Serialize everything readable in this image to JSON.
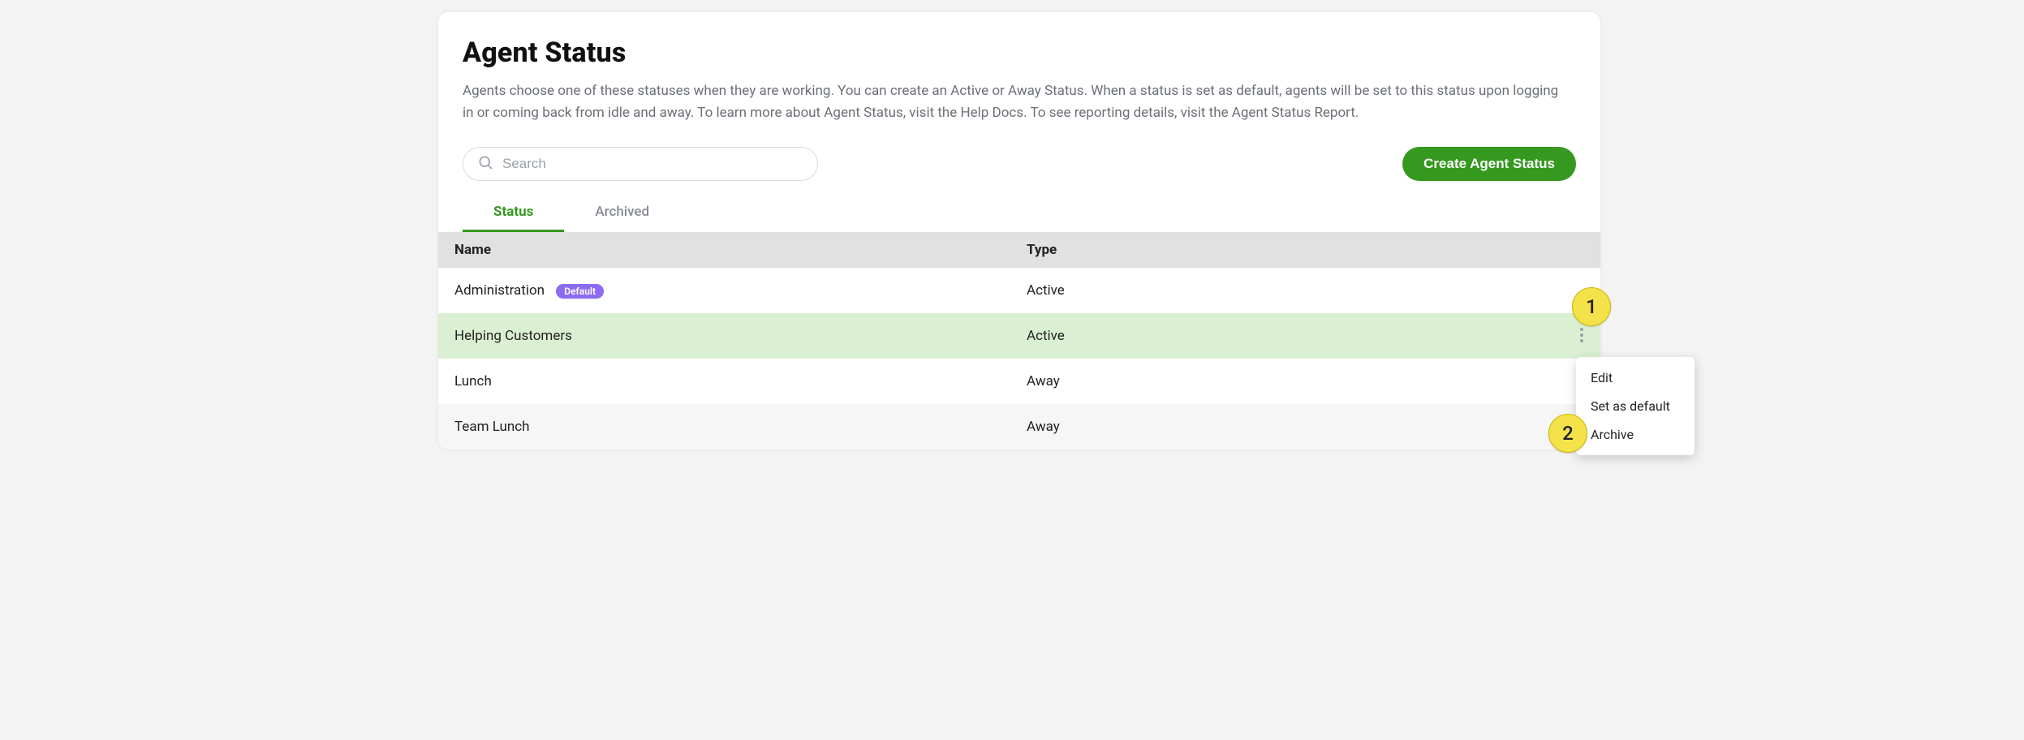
{
  "page": {
    "title": "Agent Status",
    "description": "Agents choose one of these statuses when they are working. You can create an Active or Away Status. When a status is set as default, agents will be set to this status upon logging in or coming back from idle and away. To learn more about Agent Status, visit the Help Docs. To see reporting details, visit the Agent Status Report."
  },
  "search": {
    "placeholder": "Search",
    "value": ""
  },
  "buttons": {
    "create": "Create Agent Status"
  },
  "tabs": {
    "status": "Status",
    "archived": "Archived"
  },
  "table": {
    "headers": {
      "name": "Name",
      "type": "Type"
    },
    "rows": [
      {
        "name": "Administration",
        "type": "Active",
        "is_default": true,
        "badge": "Default",
        "highlighted": false
      },
      {
        "name": "Helping Customers",
        "type": "Active",
        "is_default": false,
        "highlighted": true
      },
      {
        "name": "Lunch",
        "type": "Away",
        "is_default": false,
        "highlighted": false
      },
      {
        "name": "Team Lunch",
        "type": "Away",
        "is_default": false,
        "highlighted": false
      }
    ]
  },
  "context_menu": {
    "items": [
      "Edit",
      "Set as default",
      "Archive"
    ]
  },
  "callouts": {
    "one": "1",
    "two": "2"
  },
  "colors": {
    "accent_green": "#35991f",
    "badge_purple": "#8b6bf2",
    "callout_yellow": "#f3e24a",
    "highlight_row": "#dbf0d2"
  }
}
